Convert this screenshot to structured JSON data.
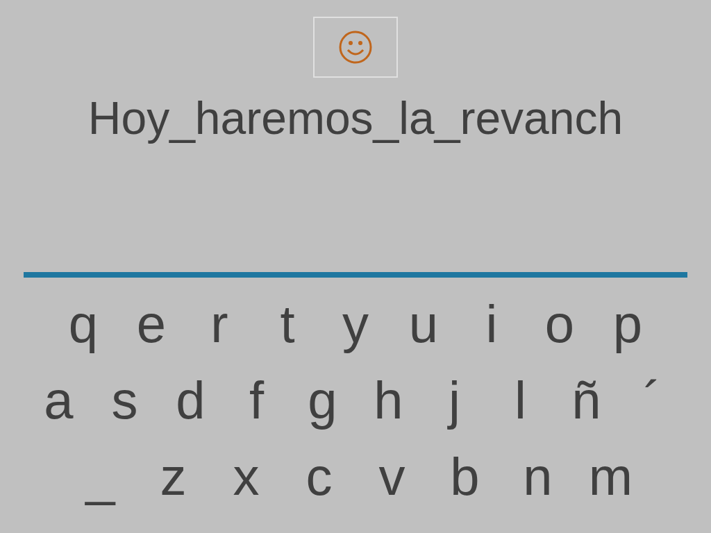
{
  "phrase": "Hoy_haremos_la_revanch",
  "keyboard": [
    [
      "q",
      "e",
      "r",
      "t",
      "y",
      "u",
      "i",
      "o",
      "p"
    ],
    [
      "a",
      "s",
      "d",
      "f",
      "g",
      "h",
      "j",
      "l",
      "ñ",
      "´"
    ],
    [
      "_",
      "z",
      "x",
      "c",
      "v",
      "b",
      "n",
      "m"
    ]
  ]
}
